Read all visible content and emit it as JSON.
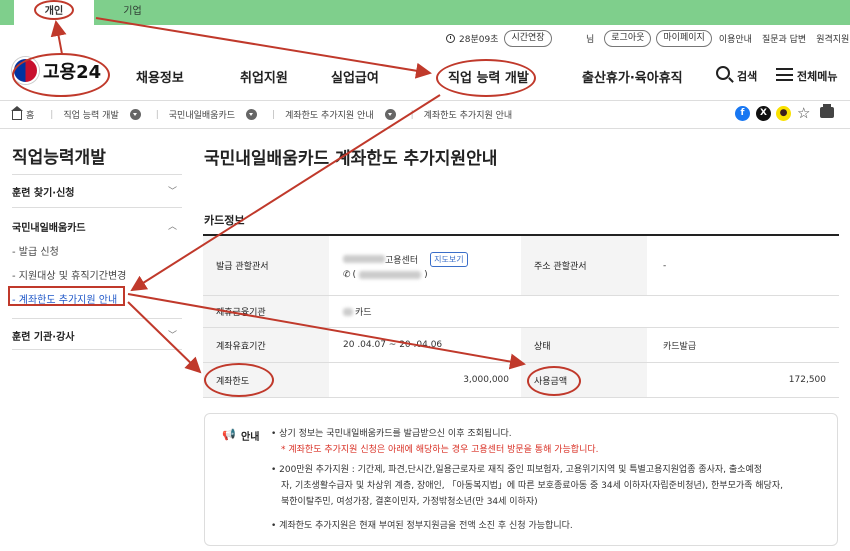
{
  "top_tabs": {
    "personal": "개인",
    "company": "기업"
  },
  "utility": {
    "timer": "28분09초",
    "extend": "시간연장",
    "separator": "님",
    "logout": "로그아웃",
    "mypage": "마이페이지",
    "links": [
      "이용안내",
      "질문과 답변",
      "원격지원"
    ]
  },
  "logo": {
    "text": "고용24"
  },
  "nav": [
    "채용정보",
    "취업지원",
    "실업급여",
    "직업 능력 개발",
    "출산휴가·육아휴직"
  ],
  "header": {
    "search": "검색",
    "menu": "전체메뉴"
  },
  "breadcrumb": [
    "홈",
    "직업 능력 개발",
    "국민내일배움카드",
    "계좌한도 추가지원 안내",
    "계좌한도 추가지원 안내"
  ],
  "share": {
    "facebook": "f",
    "x": "X",
    "kakao": "●"
  },
  "sidebar": {
    "title": "직업능력개발",
    "items": [
      "훈련 찾기·신청",
      "국민내일배움카드",
      "훈련 기관·강사"
    ],
    "subitems": [
      "- 발급 신청",
      "- 지원대상 및 휴직기간변경",
      "- 계좌한도 추가지원 안내"
    ]
  },
  "main": {
    "title": "국민내일배움카드 계좌한도 추가지원안내",
    "section": "카드정보",
    "rows": {
      "issuer_label": "발급 관할관서",
      "issuer_value": "고용센터",
      "map_button": "지도보기",
      "phone_prefix": "(",
      "phone_suffix": ")",
      "address_label": "주소 관할관서",
      "address_value": "-",
      "bank_label": "제휴금융기관",
      "bank_value": "카드",
      "period_label": "계좌유효기간",
      "period_value": "20   .04.07 ~ 20   .04.06",
      "status_label": "상태",
      "status_value": "카드발급",
      "limit_label": "계좌한도",
      "limit_value": "3,000,000",
      "used_label": "사용금액",
      "used_value": "172,500"
    }
  },
  "notice": {
    "label": "안내",
    "lines": [
      "• 상기 정보는 국민내일배움카드를 발급받으신 이후 조회됩니다.",
      "* 계좌한도 추가지원 신청은 아래에 해당하는 경우 고용센터 방문을 통해 가능합니다.",
      "• 200만원 추가지원 : 기간제, 파견,단시간,일용근로자로 재직 중인 피보험자, 고용위기지역 및 특별고용지원업종 종사자, 출소예정",
      "자, 기초생활수급자 및 차상위 계층, 장애인, 「아동복지법」에 따른 보호종료아동 중 34세 이하자(자립준비청년), 한부모가족 해당자,",
      "북한이탈주민, 여성가장, 결혼이민자, 가정밖청소년(만 34세 이하자)",
      "• 계좌한도 추가지원은 현재 부여된 정부지원금을 전액 소진 후 신청 가능합니다."
    ]
  },
  "colors": {
    "topbar": "#7fcf8c",
    "annotation": "#c0392b",
    "link": "#1f57c8",
    "notice_red": "#d93025"
  }
}
